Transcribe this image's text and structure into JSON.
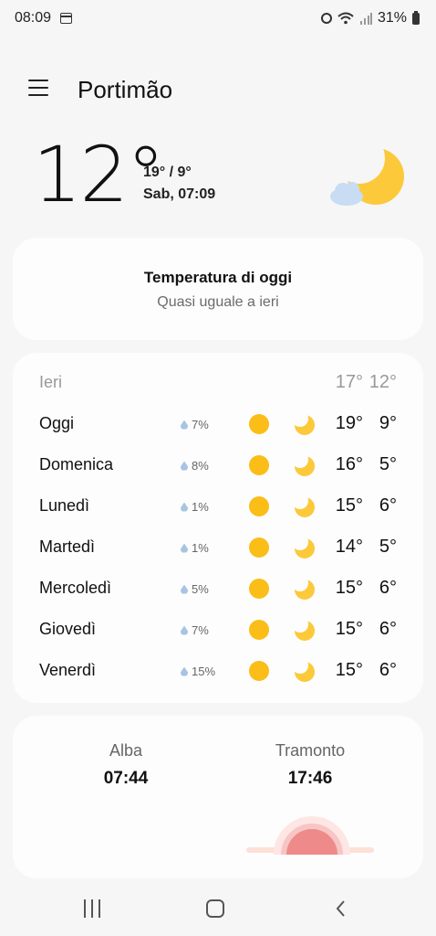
{
  "status_bar": {
    "time": "08:09",
    "battery": "31%"
  },
  "header": {
    "city": "Portimão"
  },
  "current": {
    "temperature": "12°",
    "high_low": "19° / 9°",
    "datetime": "Sab, 07:09",
    "condition_icon": "moon-cloud-icon"
  },
  "summary": {
    "title": "Temperatura di oggi",
    "subtitle": "Quasi uguale a ieri"
  },
  "forecast": {
    "yesterday": {
      "label": "Ieri",
      "high": "17°",
      "low": "12°"
    },
    "days": [
      {
        "day": "Oggi",
        "precip": "7%",
        "high": "19°",
        "low": "9°"
      },
      {
        "day": "Domenica",
        "precip": "8%",
        "high": "16°",
        "low": "5°"
      },
      {
        "day": "Lunedì",
        "precip": "1%",
        "high": "15°",
        "low": "6°"
      },
      {
        "day": "Martedì",
        "precip": "1%",
        "high": "14°",
        "low": "5°"
      },
      {
        "day": "Mercoledì",
        "precip": "5%",
        "high": "15°",
        "low": "6°"
      },
      {
        "day": "Giovedì",
        "precip": "7%",
        "high": "15°",
        "low": "6°"
      },
      {
        "day": "Venerdì",
        "precip": "15%",
        "high": "15°",
        "low": "6°"
      }
    ]
  },
  "sun": {
    "sunrise_label": "Alba",
    "sunrise_time": "07:44",
    "sunset_label": "Tramonto",
    "sunset_time": "17:46"
  },
  "colors": {
    "sun": "#fbbd17",
    "moon": "#fcc93a",
    "drop": "#a7c4e2",
    "sunset": "#ef8a8a"
  }
}
